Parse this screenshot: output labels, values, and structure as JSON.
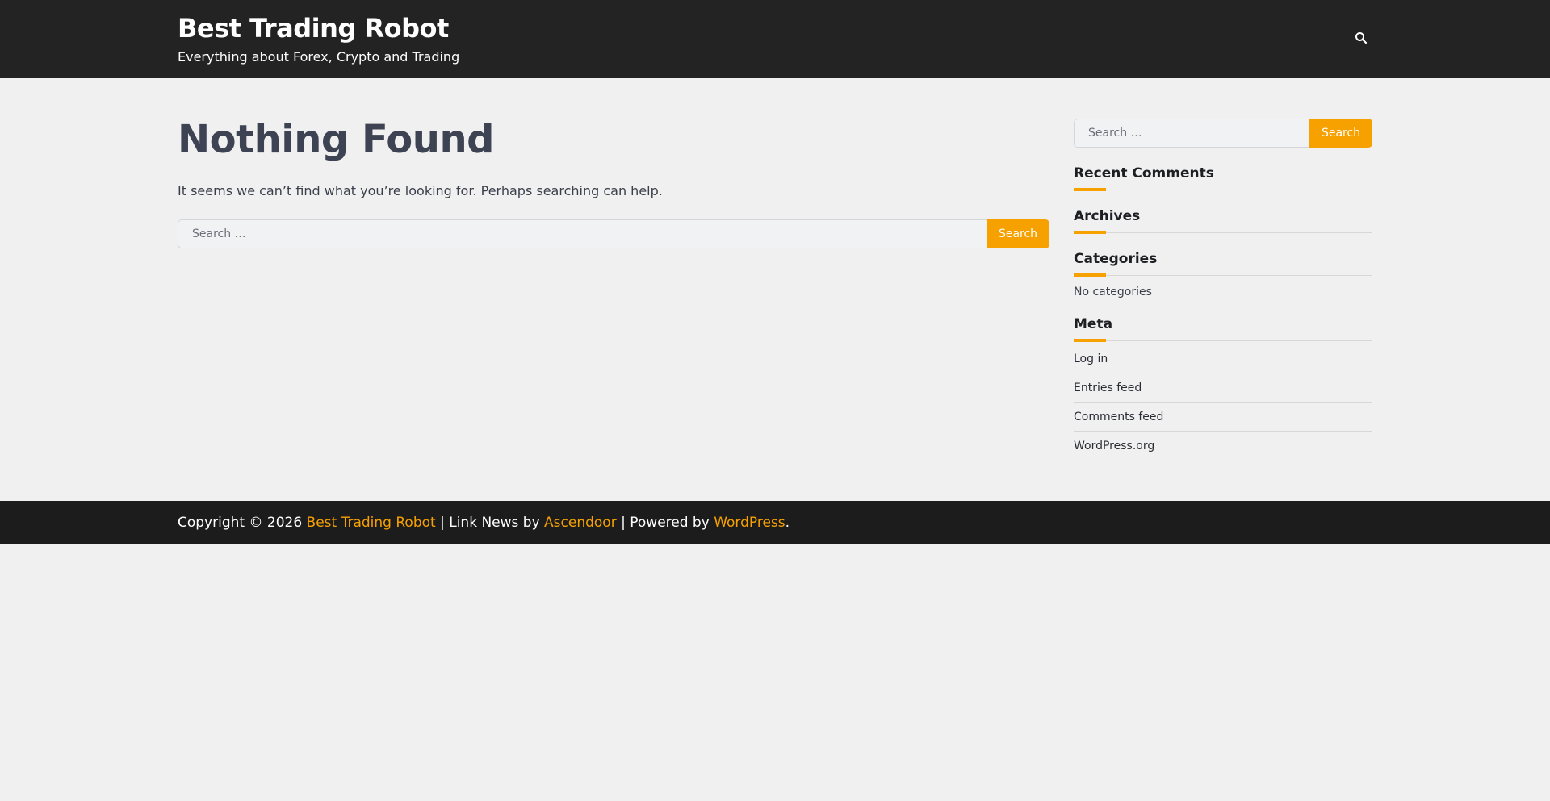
{
  "header": {
    "site_title": "Best Trading Robot",
    "tagline": "Everything about Forex, Crypto and Trading",
    "search_icon": "search-icon"
  },
  "main": {
    "title": "Nothing Found",
    "text": "It seems we can’t find what you’re looking for. Perhaps searching can help.",
    "search": {
      "placeholder": "Search …",
      "button_label": "Search"
    }
  },
  "sidebar": {
    "search": {
      "placeholder": "Search …",
      "button_label": "Search"
    },
    "widgets": {
      "recent_comments": {
        "title": "Recent Comments"
      },
      "archives": {
        "title": "Archives"
      },
      "categories": {
        "title": "Categories",
        "text": "No categories"
      },
      "meta": {
        "title": "Meta",
        "items": [
          "Log in",
          "Entries feed",
          "Comments feed",
          "WordPress.org"
        ]
      }
    }
  },
  "footer": {
    "copyright_prefix": "Copyright © 2026 ",
    "site_link": "Best Trading Robot",
    "sep1": " | Link News by ",
    "author_link": "Ascendoor",
    "sep2": " | Powered by ",
    "wp_link": "WordPress",
    "suffix": "."
  },
  "colors": {
    "accent": "#f7a100",
    "header_bg": "#232323",
    "footer_bg": "#1c1c1c",
    "page_bg": "#f0f0f0"
  }
}
